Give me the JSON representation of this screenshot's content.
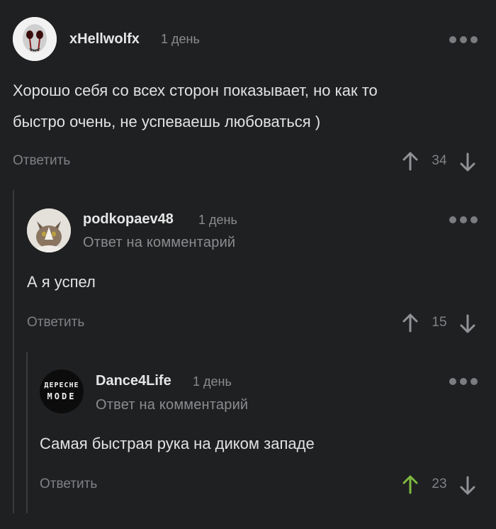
{
  "comments": [
    {
      "username": "xHellwolfx",
      "time": "1 день",
      "text": "Хорошо себя со всех сторон показывает, но как то быстро очень, не успеваешь любоваться )",
      "reply_label": "Ответить",
      "rating": "34",
      "upvoted": false
    },
    {
      "username": "podkopaev48",
      "time": "1 день",
      "subtitle": "Ответ на комментарий",
      "text": "А я успел",
      "reply_label": "Ответить",
      "rating": "15",
      "upvoted": false
    },
    {
      "username": "Dance4Life",
      "time": "1 день",
      "subtitle": "Ответ на комментарий",
      "text": "Самая быстрая рука на диком западе",
      "reply_label": "Ответить",
      "rating": "23",
      "upvoted": true,
      "avatar_text_line1": "ДEPECHE",
      "avatar_text_line2": "MODE"
    }
  ],
  "colors": {
    "background": "#1f2022",
    "muted": "#7f8185",
    "upvote_active": "#7eb93f"
  }
}
